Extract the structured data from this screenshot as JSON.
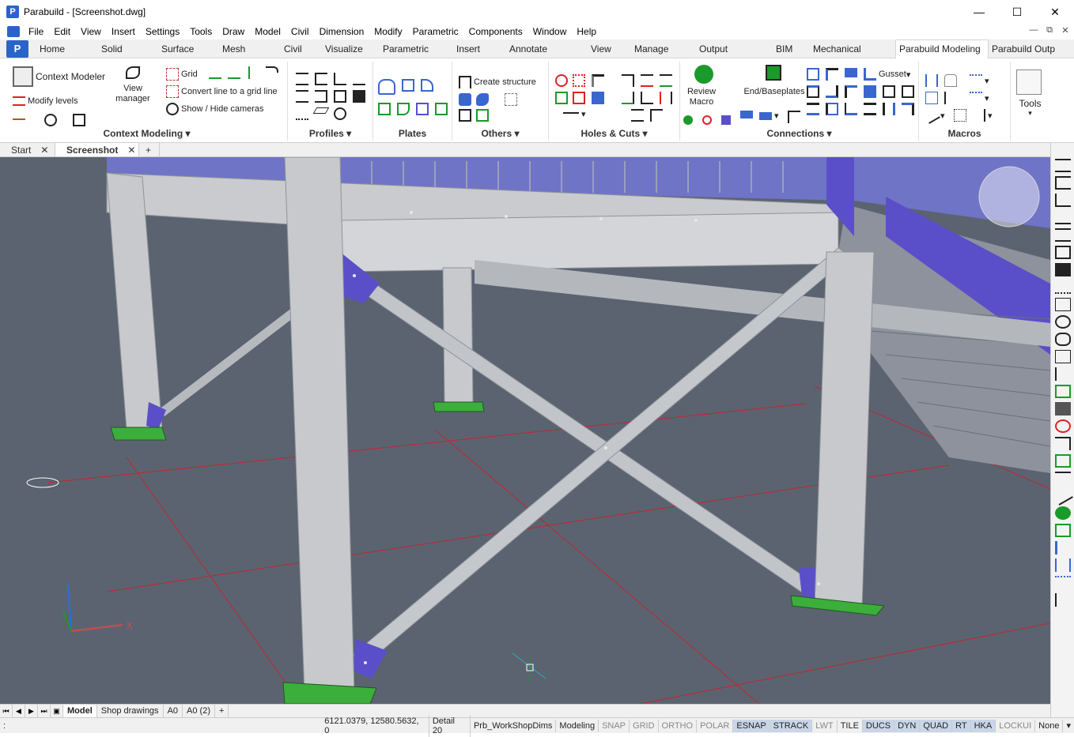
{
  "window": {
    "title": "Parabuild - [Screenshot.dwg]",
    "controls": [
      "—",
      "☐",
      "✕"
    ]
  },
  "menu": {
    "items": [
      "File",
      "Edit",
      "View",
      "Insert",
      "Settings",
      "Tools",
      "Draw",
      "Model",
      "Civil",
      "Dimension",
      "Modify",
      "Parametric",
      "Components",
      "Window",
      "Help"
    ],
    "controls": [
      "—",
      "⧉",
      "✕"
    ]
  },
  "ribbon_tabs": [
    "Home",
    "Solid",
    "Surface",
    "Mesh",
    "Civil",
    "Visualize",
    "Parametric",
    "Insert",
    "Annotate",
    "View",
    "Manage",
    "Output",
    "BIM",
    "Mechanical",
    "Parabuild Modeling",
    "Parabuild Outp"
  ],
  "active_ribbon_tab": "Parabuild Modeling",
  "panels": {
    "context_modeling": {
      "title": "Context Modeling",
      "context_modeler": "Context Modeler",
      "modify_levels": "Modify levels",
      "view_manager_1": "View",
      "view_manager_2": "manager",
      "grid": "Grid",
      "convert_line": "Convert line to a grid line",
      "show_hide_cameras": "Show / Hide cameras"
    },
    "profiles": {
      "title": "Profiles"
    },
    "plates": {
      "title": "Plates"
    },
    "others": {
      "title": "Others",
      "create_structure": "Create structure"
    },
    "holes_cuts": {
      "title": "Holes & Cuts"
    },
    "connections": {
      "title": "Connections",
      "review_macro_1": "Review",
      "review_macro_2": "Macro",
      "end_baseplates": "End/Baseplates",
      "gusset": "Gusset"
    },
    "macros": {
      "title": "Macros"
    },
    "tools": {
      "title": "Tools",
      "label": "Tools"
    }
  },
  "document_tabs": [
    {
      "label": "Start",
      "close": "✕"
    },
    {
      "label": "Screenshot",
      "close": "✕"
    },
    {
      "label": "+"
    }
  ],
  "layout_tabs": [
    "Model",
    "Shop drawings",
    "A0",
    "A0 (2)",
    "+"
  ],
  "status": {
    "prompt": ":",
    "coordinates": "6121.0379, 12580.5632, 0",
    "items": [
      "Detail 20",
      "Prb_WorkShopDims",
      "Modeling",
      "SNAP",
      "GRID",
      "ORTHO",
      "POLAR",
      "ESNAP",
      "STRACK",
      "LWT",
      "TILE",
      "DUCS",
      "DYN",
      "QUAD",
      "RT",
      "HKA",
      "LOCKUI",
      "None"
    ],
    "on": [
      "ESNAP",
      "STRACK",
      "DUCS",
      "DYN",
      "QUAD",
      "RT",
      "HKA"
    ]
  },
  "colors": {
    "viewport_bg": "#5b6371",
    "steel": "#c7c9cc",
    "plate": "#5a4fc8",
    "grid_line": "#c0272d",
    "base_plate": "#3cae3c"
  }
}
